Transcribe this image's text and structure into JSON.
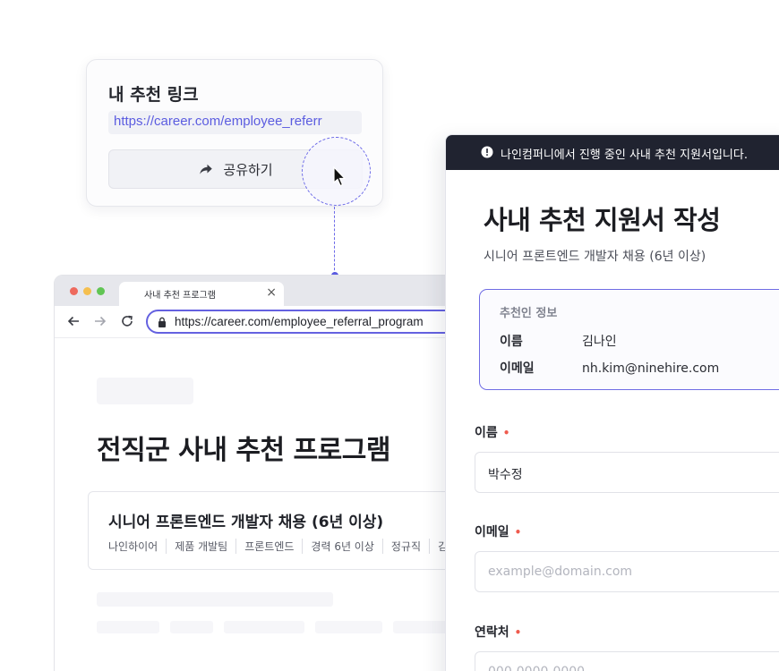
{
  "share_card": {
    "title": "내 추천 링크",
    "link": "https://career.com/employee_referr",
    "share_button_label": "공유하기"
  },
  "browser": {
    "tab_title": "사내 추천 프로그램",
    "tab_close": "×",
    "url": "https://career.com/employee_referral_program",
    "page": {
      "program_title": "전직군 사내 추천 프로그램",
      "job": {
        "title": "시니어 프론트엔드 개발자 채용 (6년 이상)",
        "tags": [
          "나인하이어",
          "제품 개발팀",
          "프론트엔드",
          "경력 6년 이상",
          "정규직",
          "김"
        ]
      }
    }
  },
  "form": {
    "notice": "나인컴퍼니에서 진행 중인 사내 추천 지원서입니다.",
    "title": "사내 추천 지원서 작성",
    "subtitle": "시니어 프론트엔드 개발자 채용 (6년 이상)",
    "referrer": {
      "heading": "추천인 정보",
      "name_label": "이름",
      "name_value": "김나인",
      "email_label": "이메일",
      "email_value": "nh.kim@ninehire.com"
    },
    "fields": {
      "name": {
        "label": "이름",
        "value": "박수정"
      },
      "email": {
        "label": "이메일",
        "placeholder": "example@domain.com"
      },
      "phone": {
        "label": "연락처",
        "placeholder": "000-0000-0000"
      }
    },
    "required_mark": "•"
  },
  "colors": {
    "accent": "#5b5ce0",
    "required": "#ef5b4e",
    "notice_bg": "#202330"
  }
}
